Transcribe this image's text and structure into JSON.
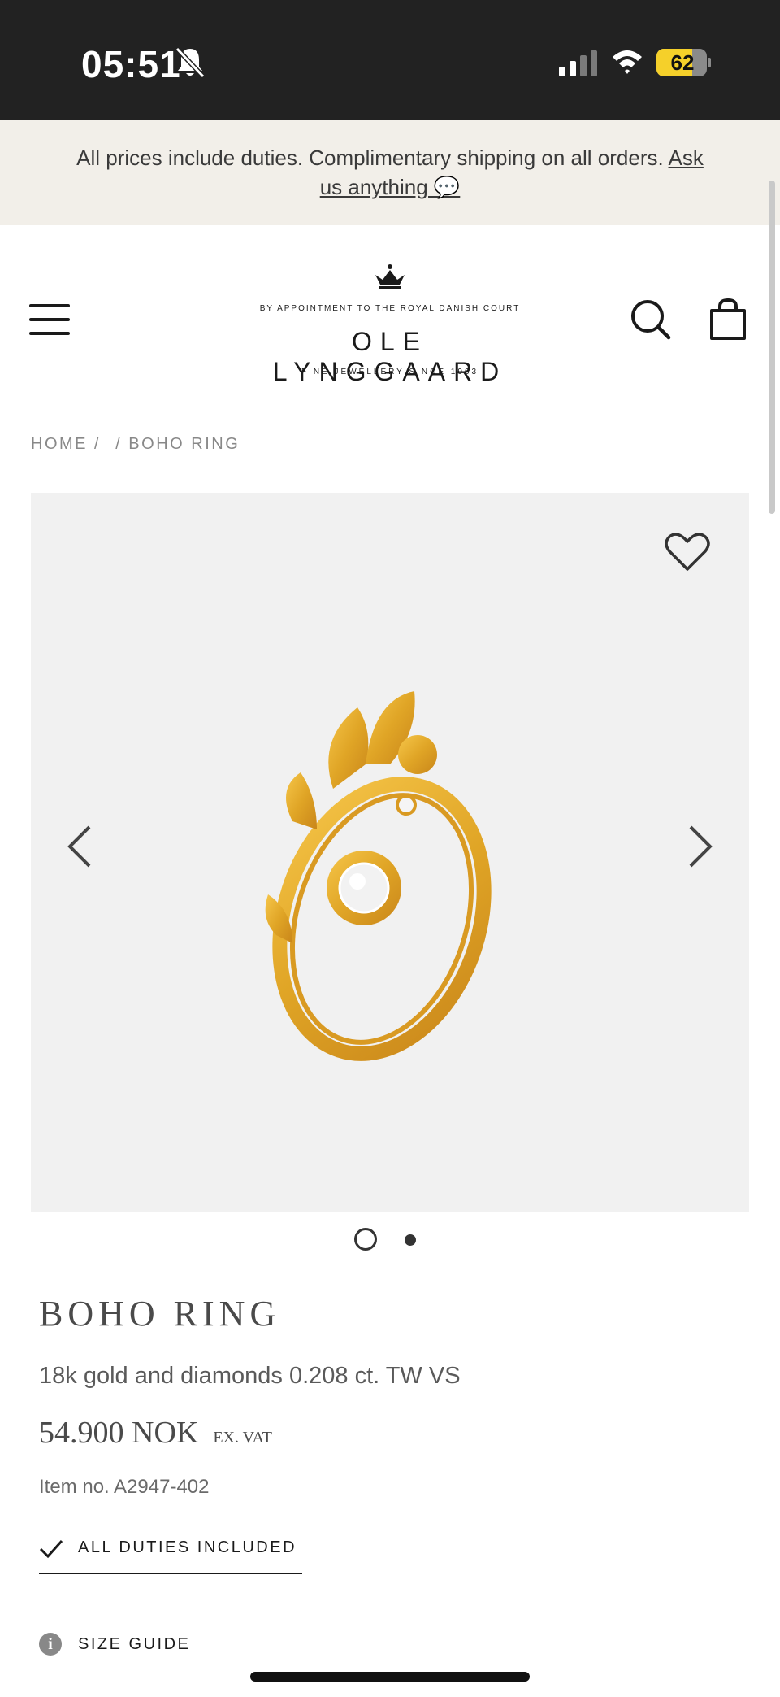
{
  "status_bar": {
    "time": "05:51",
    "battery": "62"
  },
  "announcement": {
    "text": "All prices include duties. Complimentary shipping on all orders.",
    "link_label": "Ask us anything 💬"
  },
  "brand": {
    "tagline_top": "BY APPOINTMENT TO THE ROYAL DANISH COURT",
    "name": "OLE LYNGGAARD",
    "tagline_bottom": "FINE JEWELLERY SINCE 1963"
  },
  "breadcrumb": {
    "home": "HOME /",
    "current": "/ BOHO RING"
  },
  "gallery": {
    "slide_count": 2,
    "active_slide": 1
  },
  "product": {
    "title": "BOHO RING",
    "subtitle": "18k gold and diamonds 0.208 ct. TW VS",
    "price": "54.900 NOK",
    "vat_note": "EX. VAT",
    "item_no": "Item no. A2947-402"
  },
  "duties": {
    "label": "ALL DUTIES INCLUDED"
  },
  "size_guide": {
    "label": "SIZE GUIDE"
  },
  "icons": [
    "bell-slash-icon",
    "signal-icon",
    "wifi-icon",
    "battery-icon",
    "menu-icon",
    "crown-icon",
    "search-icon",
    "bag-icon",
    "heart-icon",
    "chevron-left-icon",
    "chevron-right-icon",
    "check-icon",
    "info-icon"
  ],
  "colors": {
    "status_bar": "#222222",
    "announcement_bg": "#f2efe9",
    "gallery_bg": "#f1f1f1",
    "battery": "#f5d02a",
    "gold": "#e0a526"
  }
}
